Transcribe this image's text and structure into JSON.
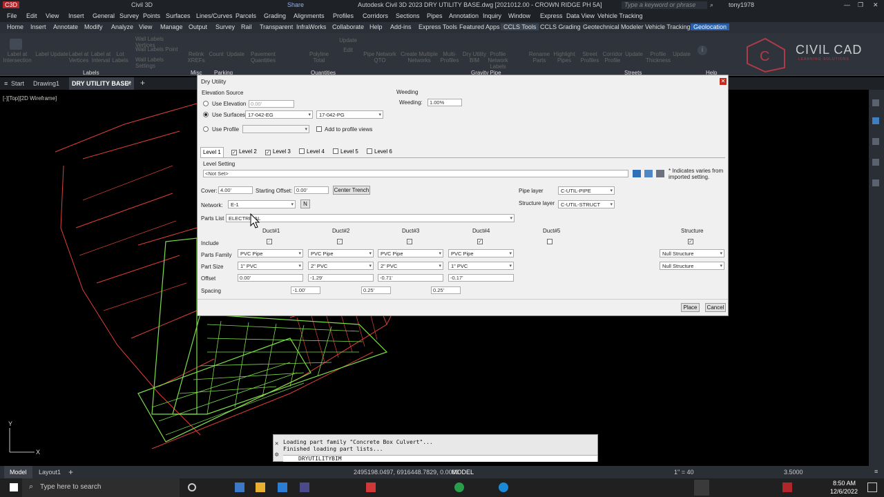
{
  "app": {
    "logo": "C3D",
    "quick_title": "Civil 3D",
    "share": "Share",
    "title": "Autodesk Civil 3D 2023   DRY UTILITY BASE.dwg [2021012.00 - CROWN RIDGE PH 5A]",
    "search_placeholder": "Type a keyword or phrase",
    "user": "tony1978"
  },
  "menu": [
    "File",
    "Edit",
    "View",
    "Insert",
    "General",
    "Survey",
    "Points",
    "Surfaces",
    "Lines/Curves",
    "Parcels",
    "Grading",
    "Alignments",
    "Profiles",
    "Corridors",
    "Sections",
    "Pipes",
    "Annotation",
    "Inquiry",
    "Window",
    "Express",
    "Data View",
    "Vehicle Tracking"
  ],
  "ribbon_tabs": [
    "Home",
    "Insert",
    "Annotate",
    "Modify",
    "Analyze",
    "View",
    "Manage",
    "Output",
    "Survey",
    "Rail",
    "Transparent",
    "InfraWorks",
    "Collaborate",
    "Help",
    "Add-ins",
    "Express Tools",
    "Featured Apps",
    "CCLS Tools",
    "CCLS Grading",
    "Geotechnical Modeler",
    "Vehicle Tracking",
    "Geolocation"
  ],
  "ribbon_buttons": [
    "Label at Intersection",
    "Label Update",
    "Label at Vertices",
    "Label at Interval",
    "Lot Labels",
    "Wall Labels Vertices",
    "Wall Labels Point",
    "Wall Labels Settings",
    "Relink XREFs",
    "Count",
    "Update",
    "Pavement Quantities",
    "Polyline Total",
    "Update",
    "Edit",
    "Pipe Network QTO",
    "Create Multiple Networks",
    "Multi-Profiles",
    "Dry Utility BIM",
    "Profile Network Labels",
    "Rename Parts",
    "Highlight Pipes",
    "Street Profiles",
    "Corridor Profile",
    "Update",
    "Profile Thickness",
    "Update"
  ],
  "ribbon_groups": [
    "Labels",
    "Misc",
    "Parking",
    "Quantities",
    "Gravity Pipe",
    "Streets",
    "Help"
  ],
  "brand": {
    "name": "CIVIL CAD",
    "sub": "LEARNING SOLUTIONS"
  },
  "doc_tabs": {
    "start": "Start",
    "drawing1": "Drawing1",
    "current": "DRY UTILITY BASE*"
  },
  "viewport_label": "[-][Top][2D Wireframe]",
  "dialog": {
    "title": "Dry Utility",
    "elevation_source": "Elevation Source",
    "use_elevation": "Use Elevation",
    "use_elevation_value": "0.00'",
    "use_surfaces": "Use Surfaces",
    "surface1": "17-042-EG",
    "surface2": "17-042-PG",
    "use_profile": "Use Profile",
    "add_to_profile": "Add to profile views",
    "weeding_group": "Weeding",
    "weeding_label": "Weeding:",
    "weeding_value": "1.00%",
    "tabs": [
      "Level 1",
      "Level 2",
      "Level 3",
      "Level 4",
      "Level 5",
      "Level 6"
    ],
    "level_setting": "Level Setting",
    "level_setting_value": "<Not Set>",
    "varies_note": "* Indicates varies from imported setting.",
    "cover_label": "Cover:",
    "cover_value": "4.00'",
    "start_offset_label": "Starting Offset:",
    "start_offset_value": "0.00'",
    "center_trench": "Center Trench",
    "network_label": "Network:",
    "network_value": "E-1",
    "network_btn": "N",
    "parts_list_label": "Parts List",
    "parts_list_value": "ELECTRICAL",
    "pipe_layer_label": "Pipe layer",
    "pipe_layer_value": "C-UTIL-PIPE",
    "structure_layer_label": "Structure layer",
    "structure_layer_value": "C-UTIL-STRUCT",
    "row_labels": [
      "Include",
      "Parts Family",
      "Part Size",
      "Offset",
      "Spacing"
    ],
    "ducts": [
      {
        "name": "Duct#1",
        "family": "PVC Pipe",
        "size": "1\" PVC",
        "offset": "0.00'",
        "spacing": "-1.00'"
      },
      {
        "name": "Duct#2",
        "family": "PVC Pipe",
        "size": "2\" PVC",
        "offset": "-1.29'",
        "spacing": "0.25'"
      },
      {
        "name": "Duct#3",
        "family": "PVC Pipe",
        "size": "2\" PVC",
        "offset": "-0.71'",
        "spacing": "0.25'"
      },
      {
        "name": "Duct#4",
        "family": "PVC Pipe",
        "size": "1\" PVC",
        "offset": "-0.17'",
        "spacing": ""
      }
    ],
    "duct5": "Duct#5",
    "structure_header": "Structure",
    "structure_family": "Null Structure",
    "structure_size": "Null Structure",
    "place": "Place",
    "cancel": "Cancel"
  },
  "command": {
    "line1": "Loading part family \"Concrete Box Culvert\"...",
    "line2": "Finished loading part lists...",
    "input": "DRYUTILITYBIM"
  },
  "status": {
    "model_tab": "Model",
    "layout_tab": "Layout1",
    "coords": "2495198.0497, 6916448.7829, 0.0000",
    "space": "MODEL",
    "scale": "1\" = 40",
    "decimal": "3.5000"
  },
  "taskbar": {
    "search_placeholder": "Type here to search",
    "time": "8:50 AM",
    "date": "12/6/2022"
  },
  "colors": {
    "geo_tab": "#2a5fa8",
    "grid_green": "#7ee04a",
    "lot_red": "#e0403a"
  }
}
